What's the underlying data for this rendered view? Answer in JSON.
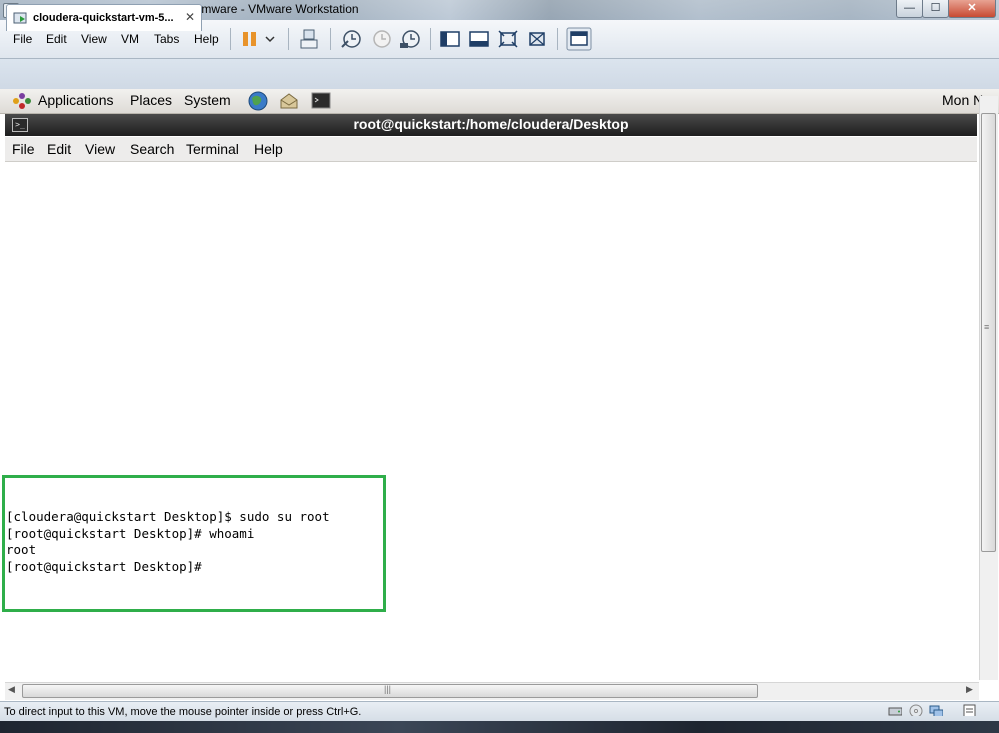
{
  "window": {
    "title": "cloudera-quickstart-vm-5.12.0-0-vmware - VMware Workstation",
    "close_glyph": "✕",
    "min_glyph": "—",
    "max_glyph": "☐"
  },
  "vmware_menu": [
    "File",
    "Edit",
    "View",
    "VM",
    "Tabs",
    "Help"
  ],
  "vm_tab": {
    "label": "cloudera-quickstart-vm-5...",
    "close_glyph": "✕"
  },
  "gnome_panel": {
    "menus": [
      "Applications",
      "Places",
      "System"
    ],
    "clock": "Mon N"
  },
  "terminal": {
    "title": "root@quickstart:/home/cloudera/Desktop",
    "menus": [
      "File",
      "Edit",
      "View",
      "Search",
      "Terminal",
      "Help"
    ],
    "lines": [
      "[cloudera@quickstart Desktop]$ sudo su root",
      "[root@quickstart Desktop]# whoami",
      "root",
      "[root@quickstart Desktop]#"
    ]
  },
  "status_bar": {
    "text": "To direct input to this VM, move the mouse pointer inside or press Ctrl+G."
  },
  "colors": {
    "highlight_border": "#2fae4a",
    "terminal_title_bg": "#1e1e1e"
  }
}
